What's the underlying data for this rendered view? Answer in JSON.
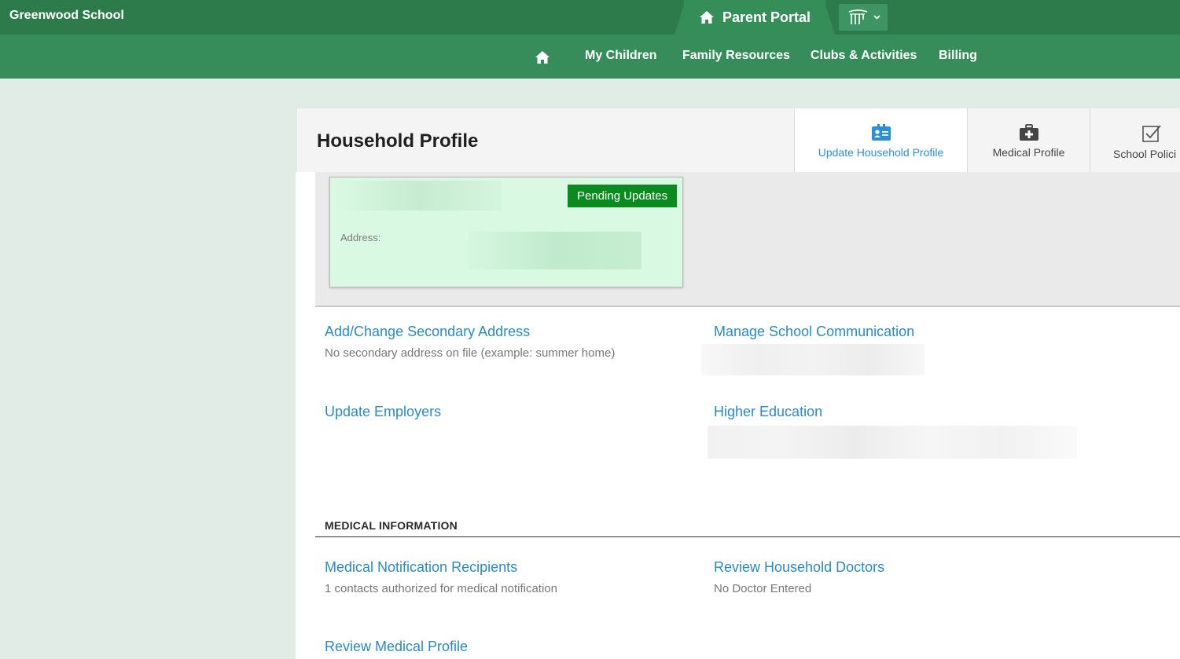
{
  "topbar": {
    "school_name": "Greenwood School",
    "portal_label": "Parent Portal",
    "portal_icon": "home-icon",
    "app_switcher_icon": "columns-logo-icon"
  },
  "nav": {
    "home_icon": "home-icon",
    "items": [
      "My Children",
      "Family Resources",
      "Clubs & Activities",
      "Billing"
    ]
  },
  "page": {
    "title": "Household Profile",
    "tabs": [
      {
        "label": "Update Household Profile",
        "icon": "id-card-icon",
        "active": true
      },
      {
        "label": "Medical Profile",
        "icon": "medical-kit-icon",
        "active": false
      },
      {
        "label": "School Polici",
        "icon": "checkbox-icon",
        "active": false
      }
    ]
  },
  "address_card": {
    "badge": "Pending Updates",
    "address_label": "Address:"
  },
  "links": {
    "secondary_address": {
      "title": "Add/Change Secondary Address",
      "subtitle": "No secondary address on file (example: summer home)"
    },
    "school_communication": {
      "title": "Manage School Communication"
    },
    "employers": {
      "title": "Update Employers"
    },
    "higher_education": {
      "title": "Higher Education"
    }
  },
  "medical_section": {
    "heading": "MEDICAL INFORMATION",
    "notification_recipients": {
      "title": "Medical Notification Recipients",
      "subtitle": "1 contacts authorized for medical notification"
    },
    "household_doctors": {
      "title": "Review Household Doctors",
      "subtitle": "No Doctor Entered"
    },
    "medical_profile": {
      "title": "Review Medical Profile"
    }
  },
  "colors": {
    "topbar": "#2d7a4b",
    "navbar": "#378d5a",
    "link": "#2a8ac6",
    "active_tab": "#2b8fd6",
    "badge": "#0b8a20",
    "address_card": "#d9f9e3"
  }
}
